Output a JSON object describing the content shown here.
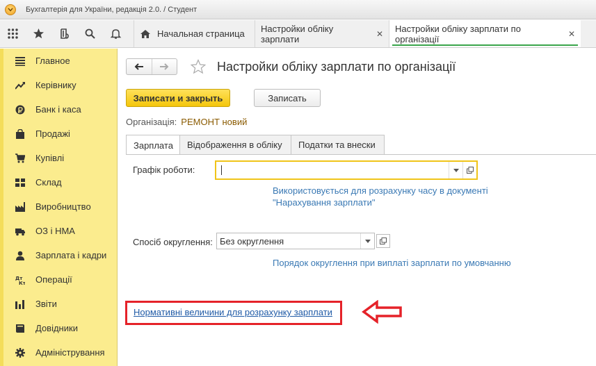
{
  "window": {
    "title": "Бухгалтерія для України, редакція 2.0. / Студент"
  },
  "tabs": [
    {
      "label": "Начальная страница",
      "icon": "home-icon"
    },
    {
      "label": "Настройки обліку зарплати",
      "close": "✕"
    },
    {
      "label": "Настройки обліку зарплати по організації",
      "close": "✕",
      "active": true
    }
  ],
  "sidebar": {
    "items": [
      {
        "label": "Главное",
        "icon": "menu-lines-icon"
      },
      {
        "label": "Керівнику",
        "icon": "trend-icon"
      },
      {
        "label": "Банк і каса",
        "icon": "coin-icon"
      },
      {
        "label": "Продажі",
        "icon": "shopping-bag-icon"
      },
      {
        "label": "Купівлі",
        "icon": "cart-icon"
      },
      {
        "label": "Склад",
        "icon": "warehouse-icon"
      },
      {
        "label": "Виробництво",
        "icon": "factory-icon"
      },
      {
        "label": "ОЗ і НМА",
        "icon": "truck-icon"
      },
      {
        "label": "Зарплата і кадри",
        "icon": "person-icon"
      },
      {
        "label": "Операції",
        "icon": "dt-kt-icon"
      },
      {
        "label": "Звіти",
        "icon": "bar-chart-icon"
      },
      {
        "label": "Довідники",
        "icon": "book-icon"
      },
      {
        "label": "Адміністрування",
        "icon": "gear-icon"
      }
    ]
  },
  "form": {
    "title": "Настройки обліку зарплати по організації",
    "save_close_label": "Записати и закрыть",
    "save_label": "Записать",
    "org_label": "Організація:",
    "org_value": "РЕМОНТ новий",
    "tabs": [
      "Зарплата",
      "Відображення в обліку",
      "Податки та внески"
    ],
    "schedule_label": "Графік роботи:",
    "schedule_value": "",
    "schedule_hint_1": "Використовується для розрахунку часу в документі",
    "schedule_hint_2": "\"Нарахування зарплати\"",
    "rounding_label": "Спосіб округлення:",
    "rounding_value": "Без округлення",
    "rounding_hint": "Порядок округлення при виплаті зарплати по умовчанню",
    "norms_link": "Нормативні величини для розрахунку зарплати"
  },
  "colors": {
    "sidebar": "#fbec8e",
    "primary_button": "#f4c60c",
    "highlight": "#e52229",
    "link": "#1f5aa6",
    "hint": "#3a79b4"
  }
}
